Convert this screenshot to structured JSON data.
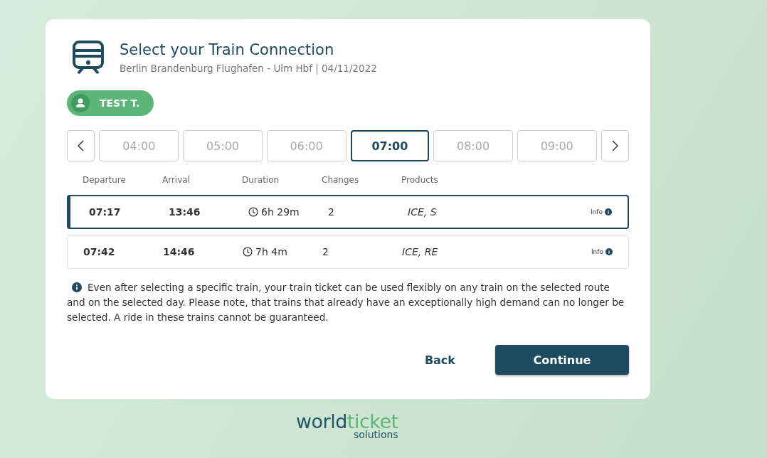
{
  "header": {
    "title": "Select your Train Connection",
    "subtitle": "Berlin Brandenburg Flughafen - Ulm Hbf | 04/11/2022"
  },
  "passenger": {
    "name": "TEST T."
  },
  "hours": [
    {
      "label": "04:00",
      "selected": false
    },
    {
      "label": "05:00",
      "selected": false
    },
    {
      "label": "06:00",
      "selected": false
    },
    {
      "label": "07:00",
      "selected": true
    },
    {
      "label": "08:00",
      "selected": false
    },
    {
      "label": "09:00",
      "selected": false
    }
  ],
  "table": {
    "columns": [
      "Departure",
      "Arrival",
      "Duration",
      "Changes",
      "Products"
    ],
    "rows": [
      {
        "departure": "07:17",
        "arrival": "13:46",
        "duration": "6h 29m",
        "changes": "2",
        "products": "ICE, S",
        "info": "Info",
        "selected": true
      },
      {
        "departure": "07:42",
        "arrival": "14:46",
        "duration": "7h 4m",
        "changes": "2",
        "products": "ICE, RE",
        "info": "Info",
        "selected": false
      }
    ]
  },
  "notice": "Even after selecting a specific train, your train ticket can be used flexibly on any train on the selected route and on the selected day. Please note, that trains that already have an exceptionally high demand can no longer be selected. A ride in these trains cannot be guaranteed.",
  "buttons": {
    "back": "Back",
    "continue": "Continue"
  },
  "logo": {
    "word_1": "world",
    "word_2": "ticket",
    "tagline": "solutions"
  }
}
